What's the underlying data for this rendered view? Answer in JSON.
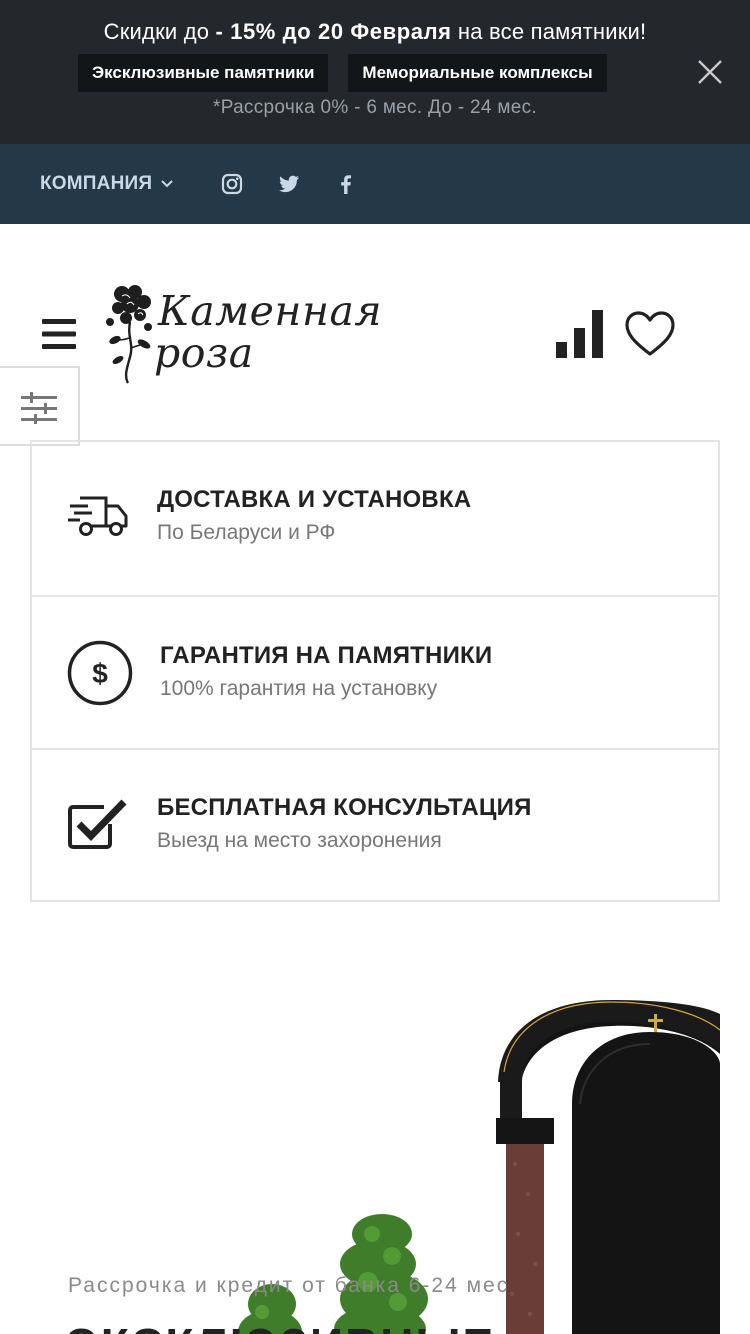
{
  "promo": {
    "text_before": "Скидки до ",
    "text_bold": "- 15% до 20 Февраля",
    "text_after": " на все памятники!",
    "buttons": [
      "Эксклюзивные памятники",
      "Мемориальные комплексы"
    ],
    "note": "*Рассрочка 0% - 6 мес. До - 24 мес.",
    "close_icon": "close-icon"
  },
  "topnav": {
    "company_label": "КОМПАНИЯ",
    "social_icons": [
      "instagram-icon",
      "twitter-icon",
      "facebook-icon"
    ]
  },
  "header": {
    "logo_line1": "Каменная",
    "logo_line2": "роза",
    "icons": [
      "menu-icon",
      "compare-icon",
      "heart-icon",
      "filter-icon"
    ]
  },
  "features": [
    {
      "icon": "delivery-truck-icon",
      "title": "ДОСТАВКА И УСТАНОВКА",
      "subtitle": "По Беларуси и РФ"
    },
    {
      "icon": "dollar-circle-icon",
      "title": "ГАРАНТИЯ НА ПАМЯТНИКИ",
      "subtitle": "100% гарантия на установку"
    },
    {
      "icon": "checkbox-icon",
      "title": "БЕСПЛАТНАЯ КОНСУЛЬТАЦИЯ",
      "subtitle": "Выезд на место захоронения"
    }
  ],
  "hero": {
    "subtitle": "Рассрочка и кредит от банка 6-24 мес",
    "title": "ЭКСКЛЮЗИВНЫЕ"
  },
  "colors": {
    "promo_bg": "#24282d",
    "nav_bg": "#243847",
    "nav_text": "#c9d8e4",
    "text_dark": "#222222",
    "text_muted": "#777777"
  }
}
